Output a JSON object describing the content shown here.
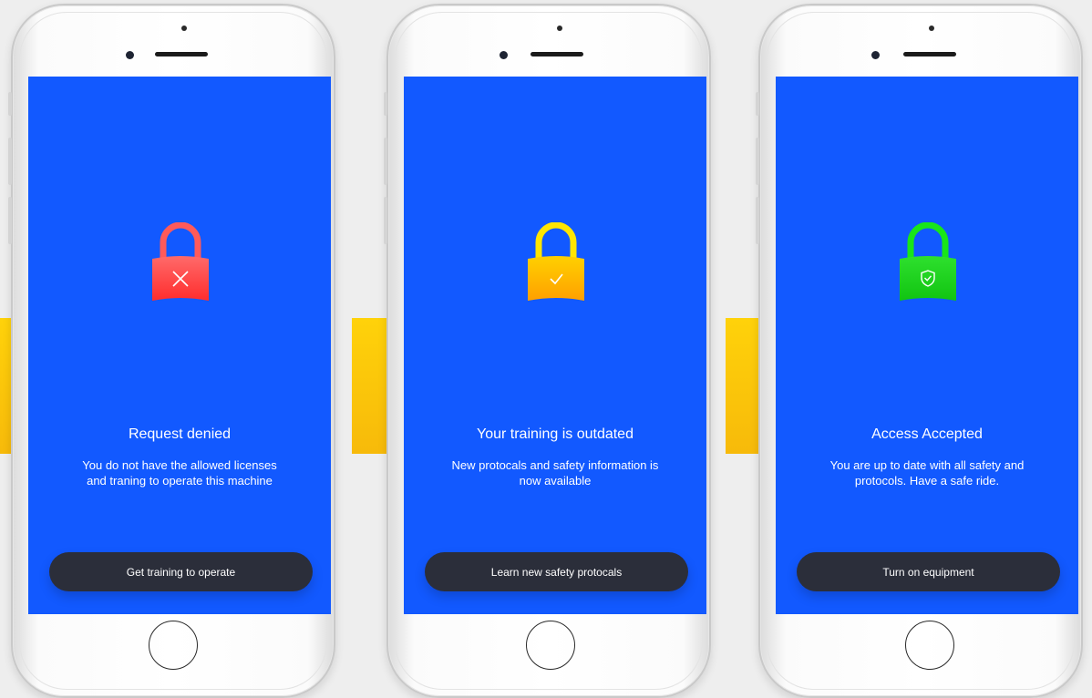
{
  "colors": {
    "background": "#eeeeee",
    "screen": "#1259ff",
    "button": "#2b2e3a",
    "band": "#ffd20a",
    "denied": "#ff3b3b",
    "outdated": "#ffb400",
    "accepted": "#19d11d"
  },
  "phones": [
    {
      "status": "denied",
      "icon": "lock-x-icon",
      "title": "Request denied",
      "description": "You do not have the allowed licenses and traning to operate this machine",
      "button_label": "Get training to operate"
    },
    {
      "status": "outdated",
      "icon": "lock-check-icon",
      "title": "Your training is outdated",
      "description": "New protocals and safety information is now available",
      "button_label": "Learn new safety protocals"
    },
    {
      "status": "accepted",
      "icon": "lock-shield-icon",
      "title": "Access Accepted",
      "description": "You are up to date with all safety and protocols. Have a safe ride.",
      "button_label": "Turn on equipment"
    }
  ]
}
